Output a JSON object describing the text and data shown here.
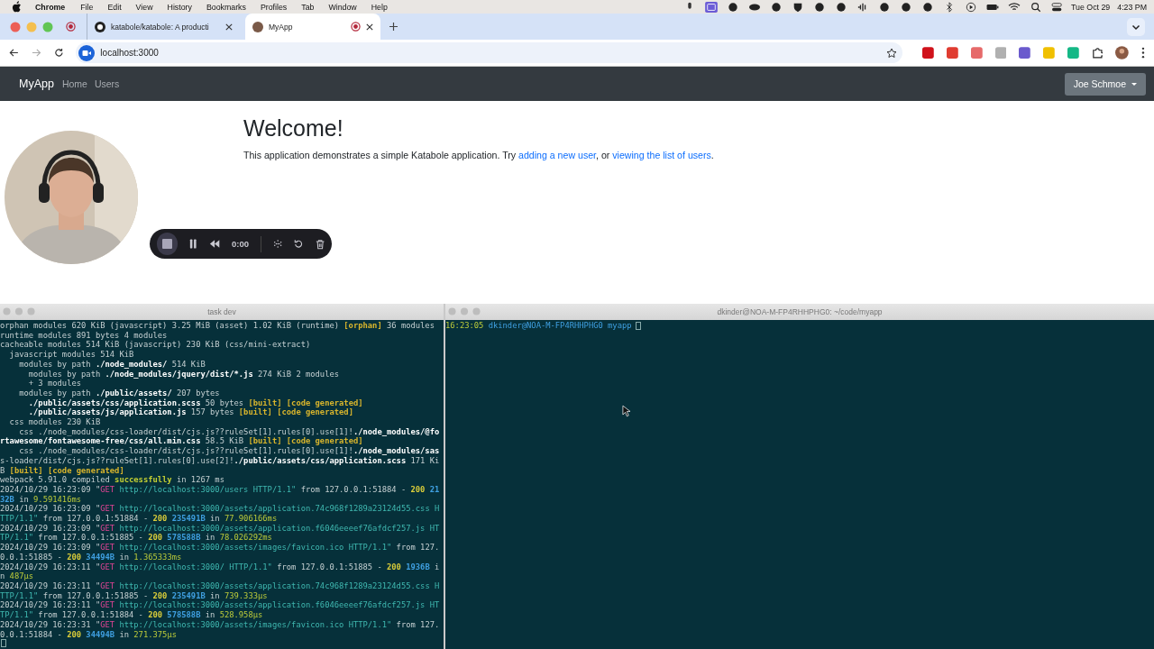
{
  "menu_bar": {
    "app": "Chrome",
    "menus": [
      "File",
      "Edit",
      "View",
      "History",
      "Bookmarks",
      "Profiles",
      "Tab",
      "Window",
      "Help"
    ],
    "date": "Tue Oct 29",
    "time": "4:23 PM"
  },
  "browser": {
    "tabs": [
      {
        "title": "katabole/katabole: A producti",
        "selected": false
      },
      {
        "title": "MyApp",
        "selected": true
      }
    ],
    "address": "localhost:3000"
  },
  "page": {
    "brand": "MyApp",
    "nav": [
      "Home",
      "Users"
    ],
    "user_menu": "Joe Schmoe",
    "heading": "Welcome!",
    "intro": [
      {
        "kind": "text",
        "text": "This application demonstrates a simple Katabole application. Try "
      },
      {
        "kind": "link",
        "text": "adding a new user"
      },
      {
        "kind": "text",
        "text": ", or "
      },
      {
        "kind": "link",
        "text": "viewing the list of users"
      },
      {
        "kind": "text",
        "text": "."
      }
    ]
  },
  "recorder": {
    "time": "0:00"
  },
  "terminals": [
    {
      "title": "task dev",
      "cursor_inline": false,
      "lines": [
        [
          {
            "kind": "plain",
            "text": "orphan modules 620 KiB (javascript) 3.25 MiB (asset) 1.02 KiB (runtime) "
          },
          {
            "kind": "tag",
            "text": "[orphan]"
          },
          {
            "kind": "plain",
            "text": " 36 modules"
          }
        ],
        [
          {
            "kind": "plain",
            "text": "runtime modules 891 bytes 4 modules"
          }
        ],
        [
          {
            "kind": "plain",
            "text": "cacheable modules 514 KiB (javascript) 230 KiB (css/mini-extract)"
          }
        ],
        [
          {
            "kind": "plain",
            "text": "  javascript modules 514 KiB"
          }
        ],
        [
          {
            "kind": "plain",
            "text": "    modules by path "
          },
          {
            "kind": "bold",
            "text": "./node_modules/"
          },
          {
            "kind": "plain",
            "text": " 514 KiB"
          }
        ],
        [
          {
            "kind": "plain",
            "text": "      modules by path "
          },
          {
            "kind": "bold",
            "text": "./node_modules/jquery/dist/*.js"
          },
          {
            "kind": "plain",
            "text": " 274 KiB 2 modules"
          }
        ],
        [
          {
            "kind": "plain",
            "text": "      + 3 modules"
          }
        ],
        [
          {
            "kind": "plain",
            "text": "    modules by path "
          },
          {
            "kind": "bold",
            "text": "./public/assets/"
          },
          {
            "kind": "plain",
            "text": " 207 bytes"
          }
        ],
        [
          {
            "kind": "bold",
            "text": "      ./public/assets/css/application.scss"
          },
          {
            "kind": "plain",
            "text": " 50 bytes "
          },
          {
            "kind": "tag",
            "text": "[built] [code generated]"
          }
        ],
        [
          {
            "kind": "bold",
            "text": "      ./public/assets/js/application.js"
          },
          {
            "kind": "plain",
            "text": " 157 bytes "
          },
          {
            "kind": "tag",
            "text": "[built] [code generated]"
          }
        ],
        [
          {
            "kind": "plain",
            "text": "  css modules 230 KiB"
          }
        ],
        [
          {
            "kind": "plain",
            "text": "    css ./node_modules/css-loader/dist/cjs.js??ruleSet[1].rules[0].use[1]!"
          },
          {
            "kind": "bold",
            "text": "./node_modules/@fo"
          }
        ],
        [
          {
            "kind": "bold",
            "text": "rtawesome/fontawesome-free/css/all.min.css"
          },
          {
            "kind": "plain",
            "text": " 58.5 KiB "
          },
          {
            "kind": "tag",
            "text": "[built] [code generated]"
          }
        ],
        [
          {
            "kind": "plain",
            "text": "    css ./node_modules/css-loader/dist/cjs.js??ruleSet[1].rules[0].use[1]!"
          },
          {
            "kind": "bold",
            "text": "./node_modules/sas"
          }
        ],
        [
          {
            "kind": "plain",
            "text": "s-loader/dist/cjs.js??ruleSet[1].rules[0].use[2]!"
          },
          {
            "kind": "bold",
            "text": "./public/assets/css/application.scss"
          },
          {
            "kind": "plain",
            "text": " 171 Ki"
          }
        ],
        [
          {
            "kind": "plain",
            "text": "B "
          },
          {
            "kind": "tag",
            "text": "[built] [code generated]"
          }
        ],
        [
          {
            "kind": "plain",
            "text": "webpack 5.91.0 compiled "
          },
          {
            "kind": "ok",
            "text": "successfully"
          },
          {
            "kind": "plain",
            "text": " in 1267 ms"
          }
        ],
        [
          {
            "kind": "plain",
            "text": "2024/10/29 16:23:09 \""
          },
          {
            "kind": "method",
            "text": "GET"
          },
          {
            "kind": "url",
            "text": " http://localhost:3000/users HTTP/1.1\""
          },
          {
            "kind": "plain",
            "text": " from 127.0.0.1:51884 - "
          },
          {
            "kind": "status",
            "text": "200"
          },
          {
            "kind": "size",
            "text": " 21"
          }
        ],
        [
          {
            "kind": "size",
            "text": "32B"
          },
          {
            "kind": "plain",
            "text": " in "
          },
          {
            "kind": "time",
            "text": "9.591416ms"
          }
        ],
        [
          {
            "kind": "plain",
            "text": "2024/10/29 16:23:09 \""
          },
          {
            "kind": "method",
            "text": "GET"
          },
          {
            "kind": "url",
            "text": " http://localhost:3000/assets/application.74c968f1289a23124d55.css H"
          }
        ],
        [
          {
            "kind": "url",
            "text": "TTP/1.1\""
          },
          {
            "kind": "plain",
            "text": " from 127.0.0.1:51884 - "
          },
          {
            "kind": "status",
            "text": "200"
          },
          {
            "kind": "size",
            "text": " 235491B"
          },
          {
            "kind": "plain",
            "text": " in "
          },
          {
            "kind": "time",
            "text": "77.906166ms"
          }
        ],
        [
          {
            "kind": "plain",
            "text": "2024/10/29 16:23:09 \""
          },
          {
            "kind": "method",
            "text": "GET"
          },
          {
            "kind": "url",
            "text": " http://localhost:3000/assets/application.f6046eeeef76afdcf257.js HT"
          }
        ],
        [
          {
            "kind": "url",
            "text": "TP/1.1\""
          },
          {
            "kind": "plain",
            "text": " from 127.0.0.1:51885 - "
          },
          {
            "kind": "status",
            "text": "200"
          },
          {
            "kind": "size",
            "text": " 578588B"
          },
          {
            "kind": "plain",
            "text": " in "
          },
          {
            "kind": "time",
            "text": "78.026292ms"
          }
        ],
        [
          {
            "kind": "plain",
            "text": "2024/10/29 16:23:09 \""
          },
          {
            "kind": "method",
            "text": "GET"
          },
          {
            "kind": "url",
            "text": " http://localhost:3000/assets/images/favicon.ico HTTP/1.1\""
          },
          {
            "kind": "plain",
            "text": " from 127."
          }
        ],
        [
          {
            "kind": "plain",
            "text": "0.0.1:51885 - "
          },
          {
            "kind": "status",
            "text": "200"
          },
          {
            "kind": "size",
            "text": " 34494B"
          },
          {
            "kind": "plain",
            "text": " in "
          },
          {
            "kind": "time",
            "text": "1.365333ms"
          }
        ],
        [
          {
            "kind": "plain",
            "text": "2024/10/29 16:23:11 \""
          },
          {
            "kind": "method",
            "text": "GET"
          },
          {
            "kind": "url",
            "text": " http://localhost:3000/ HTTP/1.1\""
          },
          {
            "kind": "plain",
            "text": " from 127.0.0.1:51885 - "
          },
          {
            "kind": "status",
            "text": "200"
          },
          {
            "kind": "size",
            "text": " 1936B"
          },
          {
            "kind": "plain",
            "text": " i"
          }
        ],
        [
          {
            "kind": "plain",
            "text": "n "
          },
          {
            "kind": "time",
            "text": "487µs"
          }
        ],
        [
          {
            "kind": "plain",
            "text": "2024/10/29 16:23:11 \""
          },
          {
            "kind": "method",
            "text": "GET"
          },
          {
            "kind": "url",
            "text": " http://localhost:3000/assets/application.74c968f1289a23124d55.css H"
          }
        ],
        [
          {
            "kind": "url",
            "text": "TTP/1.1\""
          },
          {
            "kind": "plain",
            "text": " from 127.0.0.1:51885 - "
          },
          {
            "kind": "status",
            "text": "200"
          },
          {
            "kind": "size",
            "text": " 235491B"
          },
          {
            "kind": "plain",
            "text": " in "
          },
          {
            "kind": "time",
            "text": "739.333µs"
          }
        ],
        [
          {
            "kind": "plain",
            "text": "2024/10/29 16:23:11 \""
          },
          {
            "kind": "method",
            "text": "GET"
          },
          {
            "kind": "url",
            "text": " http://localhost:3000/assets/application.f6046eeeef76afdcf257.js HT"
          }
        ],
        [
          {
            "kind": "url",
            "text": "TP/1.1\""
          },
          {
            "kind": "plain",
            "text": " from 127.0.0.1:51884 - "
          },
          {
            "kind": "status",
            "text": "200"
          },
          {
            "kind": "size",
            "text": " 578588B"
          },
          {
            "kind": "plain",
            "text": " in "
          },
          {
            "kind": "time",
            "text": "528.958µs"
          }
        ],
        [
          {
            "kind": "plain",
            "text": "2024/10/29 16:23:31 \""
          },
          {
            "kind": "method",
            "text": "GET"
          },
          {
            "kind": "url",
            "text": " http://localhost:3000/assets/images/favicon.ico HTTP/1.1\""
          },
          {
            "kind": "plain",
            "text": " from 127."
          }
        ],
        [
          {
            "kind": "plain",
            "text": "0.0.1:51884 - "
          },
          {
            "kind": "status",
            "text": "200"
          },
          {
            "kind": "size",
            "text": " 34494B"
          },
          {
            "kind": "plain",
            "text": " in "
          },
          {
            "kind": "time",
            "text": "271.375µs"
          }
        ]
      ]
    },
    {
      "title": "dkinder@NOA-M-FP4RHHPHG0: ~/code/myapp",
      "cursor_inline": true,
      "lines": [
        [
          {
            "kind": "time",
            "text": "16:23:05"
          },
          {
            "kind": "user",
            "text": " dkinder@NOA-M-FP4RHHPHG0"
          },
          {
            "kind": "dir",
            "text": " myapp"
          }
        ]
      ]
    }
  ]
}
